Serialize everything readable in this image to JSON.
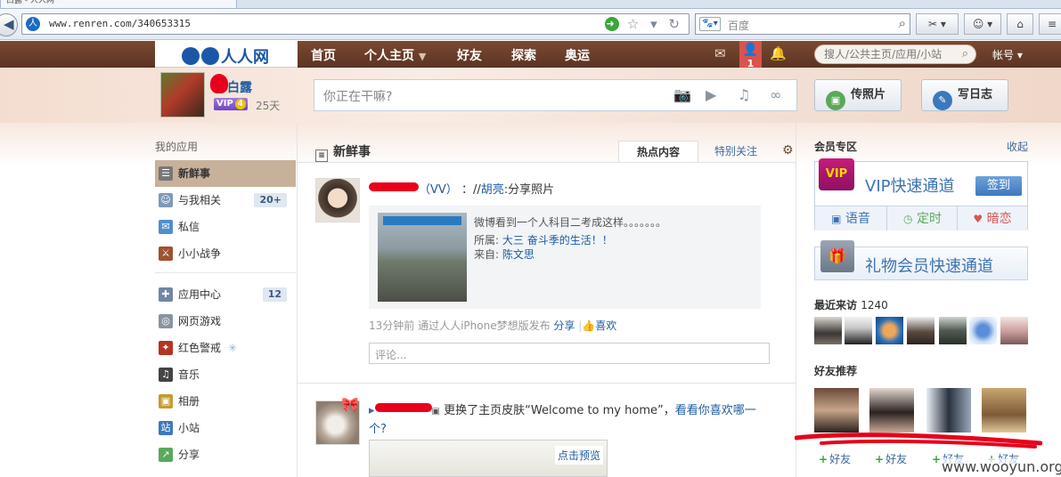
{
  "browser": {
    "tab_title": "白露 - 人人网",
    "url": "www.renren.com/340653315",
    "search_placeholder": "百度"
  },
  "nav": {
    "logo_text": "人人网",
    "items": [
      "首页",
      "个人主页",
      "好友",
      "探索",
      "奥运"
    ],
    "friend_request_count": "1",
    "search_placeholder": "搜人/公共主页/应用/小站",
    "account_label": "帐号"
  },
  "profile": {
    "name": "白露",
    "vip_label": "VIP",
    "vip_level": "4",
    "vip_days": "25天"
  },
  "composer": {
    "placeholder": "你正在干嘛?",
    "upload_photo": "传照片",
    "write_blog": "写日志"
  },
  "sidebar": {
    "title": "我的应用",
    "items": [
      {
        "label": "新鲜事",
        "badge": ""
      },
      {
        "label": "与我相关",
        "badge": "20+"
      },
      {
        "label": "私信",
        "badge": ""
      },
      {
        "label": "小小战争",
        "badge": ""
      },
      {
        "label": "应用中心",
        "badge": "12"
      },
      {
        "label": "网页游戏",
        "badge": ""
      },
      {
        "label": "红色警戒",
        "badge": ""
      },
      {
        "label": "音乐",
        "badge": ""
      },
      {
        "label": "相册",
        "badge": ""
      },
      {
        "label": "小站",
        "badge": ""
      },
      {
        "label": "分享",
        "badge": ""
      }
    ]
  },
  "feed": {
    "title": "新鲜事",
    "tab_hot": "热点内容",
    "tab_special": "特别关注",
    "post1": {
      "author_suffix": "（VV）",
      "via_prefix": "：//",
      "via_name": "胡亮",
      "action": ":分享照片",
      "share_desc": "微博看到一个人科目二考成这样。。。。。。。",
      "belong_label": "所属:",
      "belong_value": "大三 奋斗季的生活！！",
      "from_label": "来自:",
      "from_value": "陈文思",
      "time": "13分钟前 通过人人iPhone梦想版发布",
      "share": "分享",
      "like": "喜欢",
      "comment_placeholder": "评论..."
    },
    "post2": {
      "text": "更换了主页皮肤“Welcome to my home”，",
      "link": "看看你喜欢哪一个?",
      "preview": "点击预览"
    }
  },
  "right": {
    "member_title": "会员专区",
    "collapse": "收起",
    "vip_logo": "VIP",
    "vip_fast": "VIP快速通道",
    "sign_in": "签到",
    "vip_subs": [
      "语音",
      "定时",
      "暗恋"
    ],
    "gift_text": "礼物会员快速通道",
    "visitors_title": "最近来访",
    "visitors_count": "1240",
    "recommend_title": "好友推荐",
    "add_friend": "好友"
  },
  "watermark": "www.wooyun.org",
  "colors": {
    "nav_brown": "#6a3e2a",
    "link_blue": "#1e5aa0",
    "redaction_red": "#e8001c",
    "sidebar_active": "#c8b19b"
  }
}
